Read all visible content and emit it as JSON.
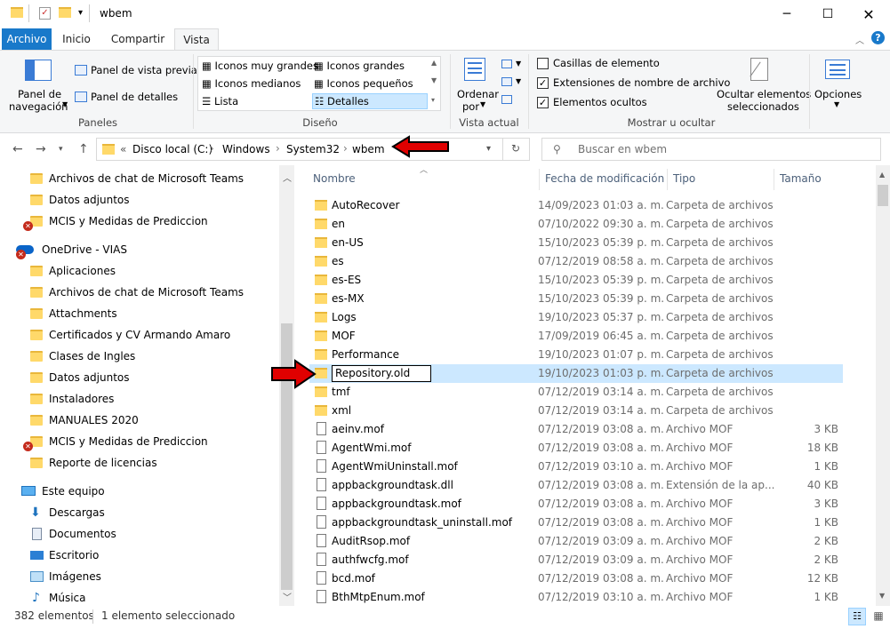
{
  "window": {
    "title": "wbem"
  },
  "tabs": [
    "Archivo",
    "Inicio",
    "Compartir",
    "Vista"
  ],
  "ribbon": {
    "panel_navegacion_line1": "Panel de",
    "panel_navegacion_line2": "navegación",
    "panel_vista_previa": "Panel de vista previa",
    "panel_detalles": "Panel de detalles",
    "group_paneles": "Paneles",
    "layouts": [
      "Iconos muy grandes",
      "Iconos grandes",
      "Iconos medianos",
      "Iconos pequeños",
      "Lista",
      "Detalles"
    ],
    "group_diseno": "Diseño",
    "ordenar_line1": "Ordenar",
    "ordenar_line2": "por",
    "group_vista_actual": "Vista actual",
    "check_casillas": "Casillas de elemento",
    "check_extensiones": "Extensiones de nombre de archivo",
    "check_ocultos": "Elementos ocultos",
    "ocultar_line1": "Ocultar elementos",
    "ocultar_line2": "seleccionados",
    "group_mostrar": "Mostrar u ocultar",
    "opciones": "Opciones"
  },
  "address": {
    "prefix": "«",
    "crumbs": [
      "Disco local (C:)",
      "Windows",
      "System32",
      "wbem"
    ]
  },
  "search": {
    "placeholder": "Buscar en wbem"
  },
  "sidebar": [
    {
      "label": "Archivos de chat de Microsoft Teams",
      "kind": "folder",
      "indent": 1
    },
    {
      "label": "Datos adjuntos",
      "kind": "folder",
      "indent": 1
    },
    {
      "label": "MCIS y Medidas de Prediccion",
      "kind": "folder-error",
      "indent": 1
    },
    {
      "label": "OneDrive - VIAS",
      "kind": "onedrive",
      "indent": 0
    },
    {
      "label": "Aplicaciones",
      "kind": "folder",
      "indent": 1
    },
    {
      "label": "Archivos de chat de Microsoft Teams",
      "kind": "folder",
      "indent": 1
    },
    {
      "label": "Attachments",
      "kind": "folder",
      "indent": 1
    },
    {
      "label": "Certificados y CV Armando Amaro",
      "kind": "folder",
      "indent": 1
    },
    {
      "label": "Clases de Ingles",
      "kind": "folder",
      "indent": 1
    },
    {
      "label": "Datos adjuntos",
      "kind": "folder",
      "indent": 1
    },
    {
      "label": "Instaladores",
      "kind": "folder",
      "indent": 1
    },
    {
      "label": "MANUALES 2020",
      "kind": "folder",
      "indent": 1
    },
    {
      "label": "MCIS y Medidas de Prediccion",
      "kind": "folder-error",
      "indent": 1
    },
    {
      "label": "Reporte de licencias",
      "kind": "folder",
      "indent": 1
    },
    {
      "label": "Este equipo",
      "kind": "pc",
      "indent": 0
    },
    {
      "label": "Descargas",
      "kind": "download",
      "indent": 1
    },
    {
      "label": "Documentos",
      "kind": "docs",
      "indent": 1
    },
    {
      "label": "Escritorio",
      "kind": "desktop",
      "indent": 1
    },
    {
      "label": "Imágenes",
      "kind": "pictures",
      "indent": 1
    },
    {
      "label": "Música",
      "kind": "music",
      "indent": 1
    }
  ],
  "columns": [
    "Nombre",
    "Fecha de modificación",
    "Tipo",
    "Tamaño"
  ],
  "files": [
    {
      "name": "AutoRecover",
      "date": "14/09/2023 01:03 a. m.",
      "type": "Carpeta de archivos",
      "size": "",
      "kind": "folder"
    },
    {
      "name": "en",
      "date": "07/10/2022 09:30 a. m.",
      "type": "Carpeta de archivos",
      "size": "",
      "kind": "folder"
    },
    {
      "name": "en-US",
      "date": "15/10/2023 05:39 p. m.",
      "type": "Carpeta de archivos",
      "size": "",
      "kind": "folder"
    },
    {
      "name": "es",
      "date": "07/12/2019 08:58 a. m.",
      "type": "Carpeta de archivos",
      "size": "",
      "kind": "folder"
    },
    {
      "name": "es-ES",
      "date": "15/10/2023 05:39 p. m.",
      "type": "Carpeta de archivos",
      "size": "",
      "kind": "folder"
    },
    {
      "name": "es-MX",
      "date": "15/10/2023 05:39 p. m.",
      "type": "Carpeta de archivos",
      "size": "",
      "kind": "folder"
    },
    {
      "name": "Logs",
      "date": "19/10/2023 05:37 p. m.",
      "type": "Carpeta de archivos",
      "size": "",
      "kind": "folder"
    },
    {
      "name": "MOF",
      "date": "17/09/2019 06:45 a. m.",
      "type": "Carpeta de archivos",
      "size": "",
      "kind": "folder"
    },
    {
      "name": "Performance",
      "date": "19/10/2023 01:07 p. m.",
      "type": "Carpeta de archivos",
      "size": "",
      "kind": "folder"
    },
    {
      "name": "Repository.old",
      "date": "19/10/2023 01:03 p. m.",
      "type": "Carpeta de archivos",
      "size": "",
      "kind": "folder",
      "selected": true
    },
    {
      "name": "tmf",
      "date": "07/12/2019 03:14 a. m.",
      "type": "Carpeta de archivos",
      "size": "",
      "kind": "folder"
    },
    {
      "name": "xml",
      "date": "07/12/2019 03:14 a. m.",
      "type": "Carpeta de archivos",
      "size": "",
      "kind": "folder"
    },
    {
      "name": "aeinv.mof",
      "date": "07/12/2019 03:08 a. m.",
      "type": "Archivo MOF",
      "size": "3 KB",
      "kind": "file"
    },
    {
      "name": "AgentWmi.mof",
      "date": "07/12/2019 03:08 a. m.",
      "type": "Archivo MOF",
      "size": "18 KB",
      "kind": "file"
    },
    {
      "name": "AgentWmiUninstall.mof",
      "date": "07/12/2019 03:10 a. m.",
      "type": "Archivo MOF",
      "size": "1 KB",
      "kind": "file"
    },
    {
      "name": "appbackgroundtask.dll",
      "date": "07/12/2019 03:08 a. m.",
      "type": "Extensión de la ap...",
      "size": "40 KB",
      "kind": "dll"
    },
    {
      "name": "appbackgroundtask.mof",
      "date": "07/12/2019 03:08 a. m.",
      "type": "Archivo MOF",
      "size": "3 KB",
      "kind": "file"
    },
    {
      "name": "appbackgroundtask_uninstall.mof",
      "date": "07/12/2019 03:08 a. m.",
      "type": "Archivo MOF",
      "size": "1 KB",
      "kind": "file"
    },
    {
      "name": "AuditRsop.mof",
      "date": "07/12/2019 03:09 a. m.",
      "type": "Archivo MOF",
      "size": "2 KB",
      "kind": "file"
    },
    {
      "name": "authfwcfg.mof",
      "date": "07/12/2019 03:09 a. m.",
      "type": "Archivo MOF",
      "size": "2 KB",
      "kind": "file"
    },
    {
      "name": "bcd.mof",
      "date": "07/12/2019 03:08 a. m.",
      "type": "Archivo MOF",
      "size": "12 KB",
      "kind": "file"
    },
    {
      "name": "BthMtpEnum.mof",
      "date": "07/12/2019 03:10 a. m.",
      "type": "Archivo MOF",
      "size": "1 KB",
      "kind": "file"
    }
  ],
  "status": {
    "count": "382 elementos",
    "selected": "1 elemento seleccionado"
  },
  "colors": {
    "accent": "#1979ca",
    "selection": "#cce8ff",
    "arrow": "#e00000"
  }
}
